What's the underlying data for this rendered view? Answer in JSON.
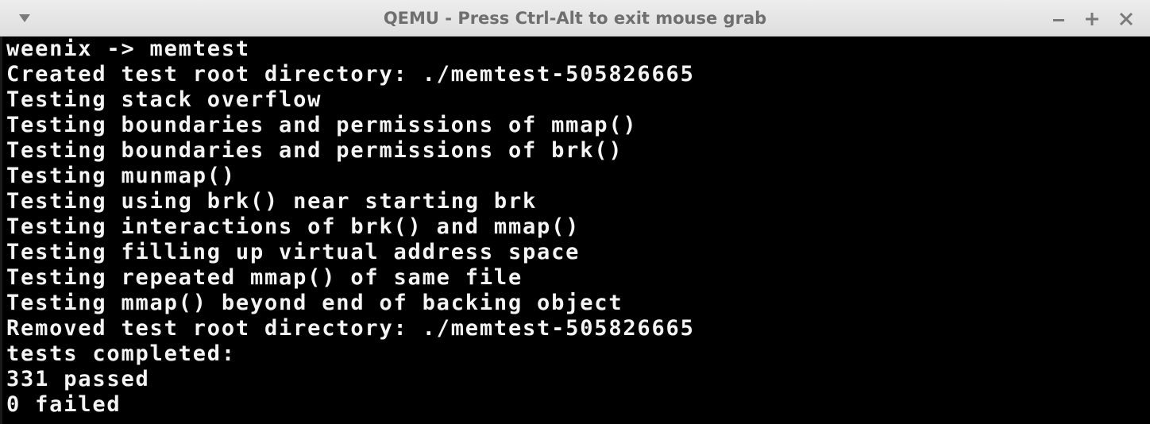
{
  "window": {
    "title": "QEMU - Press Ctrl-Alt to exit mouse grab",
    "menu_icon": "chevron-down-icon",
    "controls": [
      "minimize-icon",
      "maximize-icon",
      "close-icon"
    ]
  },
  "terminal": {
    "lines": [
      "weenix -> memtest",
      "Created test root directory: ./memtest-505826665",
      "Testing stack overflow",
      "Testing boundaries and permissions of mmap()",
      "Testing boundaries and permissions of brk()",
      "Testing munmap()",
      "Testing using brk() near starting brk",
      "Testing interactions of brk() and mmap()",
      "Testing filling up virtual address space",
      "Testing repeated mmap() of same file",
      "Testing mmap() beyond end of backing object",
      "Removed test root directory: ./memtest-505826665",
      "tests completed:",
      "331 passed",
      "0 failed"
    ],
    "colors": {
      "background": "#000000",
      "foreground": "#f4f4f4"
    }
  }
}
